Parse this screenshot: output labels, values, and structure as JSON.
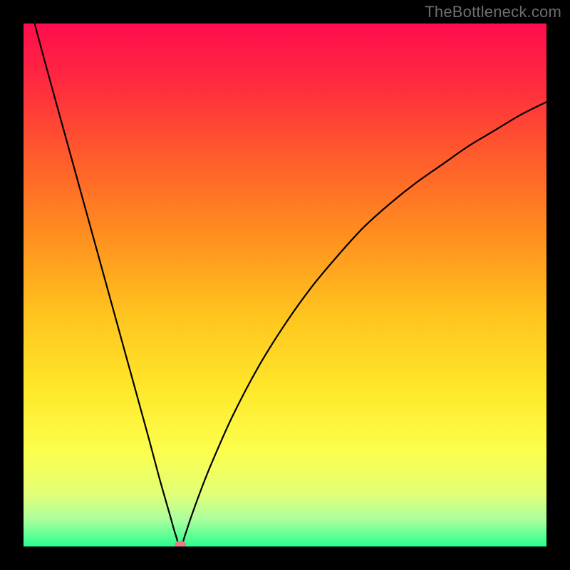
{
  "watermark": "TheBottleneck.com",
  "chart_data": {
    "type": "line",
    "title": "",
    "xlabel": "",
    "ylabel": "",
    "xlim": [
      0,
      100
    ],
    "ylim": [
      0,
      100
    ],
    "grid": false,
    "series": [
      {
        "name": "curve",
        "x": [
          0,
          4,
          8,
          12,
          16,
          20,
          24,
          26,
          28,
          29,
          30,
          31,
          32,
          34,
          36,
          40,
          45,
          50,
          55,
          60,
          65,
          70,
          75,
          80,
          85,
          90,
          95,
          100
        ],
        "values": [
          108,
          93,
          78.5,
          64,
          49.5,
          35,
          20.5,
          13,
          6,
          2.5,
          0,
          2.5,
          5.5,
          11,
          16,
          25,
          34.5,
          42.5,
          49.5,
          55.5,
          61,
          65.5,
          69.5,
          73,
          76.5,
          79.5,
          82.5,
          85
        ]
      }
    ],
    "marker": {
      "x": 30,
      "y": 0,
      "color": "#e97a88"
    },
    "background_gradient": {
      "stops": [
        {
          "offset": 0.0,
          "color": "#ff0d4e"
        },
        {
          "offset": 0.12,
          "color": "#ff2c3e"
        },
        {
          "offset": 0.25,
          "color": "#ff5a2c"
        },
        {
          "offset": 0.4,
          "color": "#ff8d1f"
        },
        {
          "offset": 0.55,
          "color": "#ffc21e"
        },
        {
          "offset": 0.7,
          "color": "#ffe82a"
        },
        {
          "offset": 0.82,
          "color": "#fcff4e"
        },
        {
          "offset": 0.9,
          "color": "#e2ff77"
        },
        {
          "offset": 0.95,
          "color": "#a8ff9e"
        },
        {
          "offset": 1.0,
          "color": "#27ff8e"
        }
      ]
    }
  }
}
